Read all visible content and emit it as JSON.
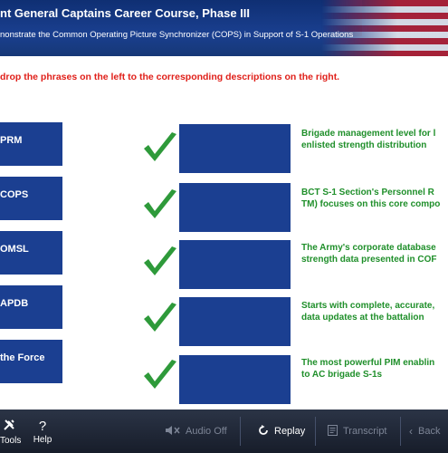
{
  "header": {
    "title": "nt General Captains Career Course, Phase III",
    "subtitle": "nonstrate the Common Operating Picture Synchronizer (COPS) in Support of S-1 Operations"
  },
  "instruction": "drop the phrases on the left to the corresponding descriptions on the right.",
  "drag_items": [
    {
      "label": "PRM"
    },
    {
      "label": "COPS"
    },
    {
      "label": "OMSL"
    },
    {
      "label": "APDB"
    },
    {
      "label": "the Force"
    }
  ],
  "descriptions": [
    {
      "line1": "Brigade management level for l",
      "line2": "enlisted strength distribution"
    },
    {
      "line1": "BCT S-1 Section's Personnel R",
      "line2": "TM) focuses on this core compo"
    },
    {
      "line1": "The Army's corporate database",
      "line2": "strength data presented in COF"
    },
    {
      "line1": "Starts with complete, accurate,",
      "line2": "data updates at the battalion"
    },
    {
      "line1": "The most powerful PIM enablin",
      "line2": "to AC brigade S-1s"
    }
  ],
  "footer": {
    "tools_label": "Tools",
    "help_label": "Help",
    "help_icon": "?",
    "audio_label": "Audio Off",
    "replay_label": "Replay",
    "transcript_label": "Transcript",
    "back_label": "Back"
  },
  "colors": {
    "navy": "#1b3f91",
    "check_green": "#2e9a3a",
    "desc_green": "#1f8f2a",
    "instruction_red": "#e0201a"
  }
}
